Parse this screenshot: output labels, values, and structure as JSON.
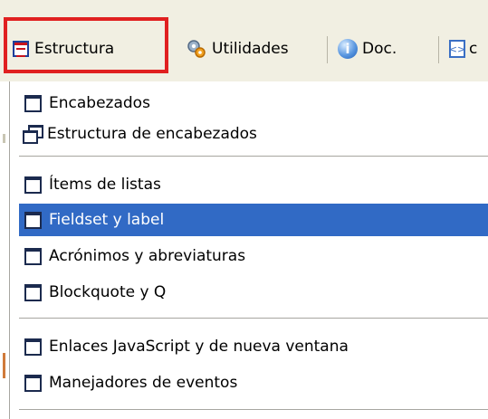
{
  "toolbar": {
    "items": [
      {
        "label": "Estructura",
        "icon": "table-structure-icon"
      },
      {
        "label": "Utilidades",
        "icon": "gear-tools-icon"
      },
      {
        "label": "Doc.",
        "icon": "info-icon"
      },
      {
        "label": "c",
        "icon": "code-icon"
      }
    ],
    "highlight_color": "#e02020"
  },
  "menu": {
    "items": [
      {
        "label": "Encabezados"
      },
      {
        "label": "Estructura de encabezados"
      },
      {
        "label": "Ítems de listas"
      },
      {
        "label": "Fieldset y label",
        "selected": true
      },
      {
        "label": "Acrónimos y abreviaturas"
      },
      {
        "label": "Blockquote y Q"
      },
      {
        "label": "Enlaces JavaScript y de nueva ventana"
      },
      {
        "label": "Manejadores de eventos"
      }
    ],
    "selection_color": "#316ac5"
  }
}
